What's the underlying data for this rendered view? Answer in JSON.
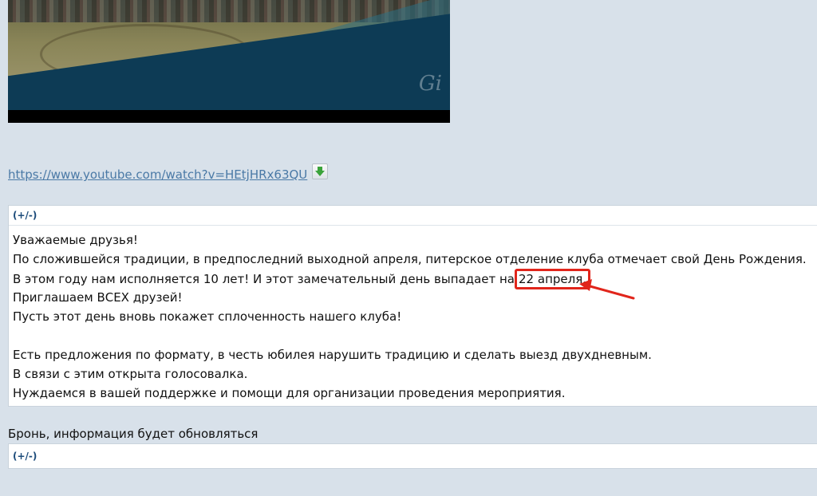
{
  "video": {
    "watermark": "Gi"
  },
  "link": {
    "url": "https://www.youtube.com/watch?v=HEtjHRx63QU",
    "download_icon": "download-arrow-icon"
  },
  "spoiler1": {
    "toggle": "(+/-)",
    "lines": [
      "Уважаемые друзья!",
      "По сложившейся традиции, в предпоследний выходной апреля, питерское отделение клуба отмечает свой День Рождения.",
      "В этом году нам исполняется 10 лет! И этот замечательный день выпадает на",
      "Приглашаем ВСЕХ друзей!",
      "Пусть этот день вновь покажет сплоченность нашего клуба!",
      "Есть предложения по формату, в честь юбилея нарушить традицию и сделать выезд двухдневным.",
      "В связи с этим открыта голосовалка.",
      "Нуждаемся в вашей поддержке и помощи для организации проведения мероприятия."
    ],
    "highlight": "22 апреля."
  },
  "section2": {
    "title": "Бронь, информация будет обновляться",
    "toggle": "(+/-)"
  },
  "colors": {
    "page_bg": "#d8e1ea",
    "link": "#4a79a6",
    "toggle": "#1c4b7a",
    "annotation_red": "#e1251b"
  }
}
